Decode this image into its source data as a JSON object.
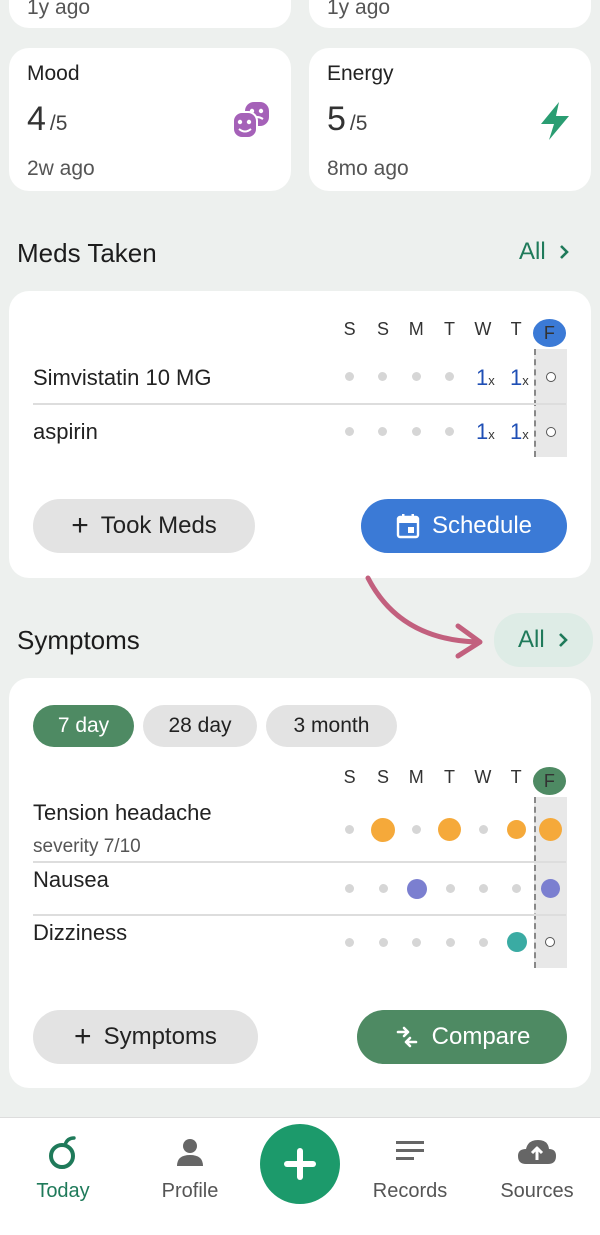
{
  "top_cards": [
    {
      "ago": "1y ago"
    },
    {
      "ago": "1y ago"
    }
  ],
  "metrics": [
    {
      "title": "Mood",
      "value": "4",
      "max": "/5",
      "ago": "2w ago",
      "icon": "theater-masks-icon",
      "icon_color": "#a561b8"
    },
    {
      "title": "Energy",
      "value": "5",
      "max": "/5",
      "ago": "8mo ago",
      "icon": "lightning-icon",
      "icon_color": "#2a9d72"
    }
  ],
  "meds": {
    "title": "Meds Taken",
    "all_label": "All",
    "days": [
      "S",
      "S",
      "M",
      "T",
      "W",
      "T",
      "F"
    ],
    "today_color": "#3b7ad6",
    "rows": [
      {
        "name": "Simvistatin 10 MG",
        "marks": [
          "",
          "",
          "",
          "",
          "1",
          "1",
          ""
        ],
        "unit": "x"
      },
      {
        "name": "aspirin",
        "marks": [
          "",
          "",
          "",
          "",
          "1",
          "1",
          ""
        ],
        "unit": "x"
      }
    ],
    "took_meds_label": "Took Meds",
    "schedule_label": "Schedule"
  },
  "symptoms": {
    "title": "Symptoms",
    "all_label": "All",
    "ranges": [
      "7 day",
      "28 day",
      "3 month"
    ],
    "selected_range": "7 day",
    "days": [
      "S",
      "S",
      "M",
      "T",
      "W",
      "T",
      "F"
    ],
    "today_color": "#4e8a63",
    "rows": [
      {
        "name": "Tension headache",
        "sub": "severity 7/10",
        "color": "#f5a93a"
      },
      {
        "name": "Nausea",
        "sub": "",
        "color": "#7b7fd0"
      },
      {
        "name": "Dizziness",
        "sub": "",
        "color": "#3aaba3"
      }
    ],
    "add_label": "Symptoms",
    "compare_label": "Compare"
  },
  "nav": {
    "items": [
      "Today",
      "Profile",
      "Records",
      "Sources"
    ],
    "active": "Today",
    "active_color": "#1f7a5a"
  },
  "annotation_color": "#c2607e"
}
